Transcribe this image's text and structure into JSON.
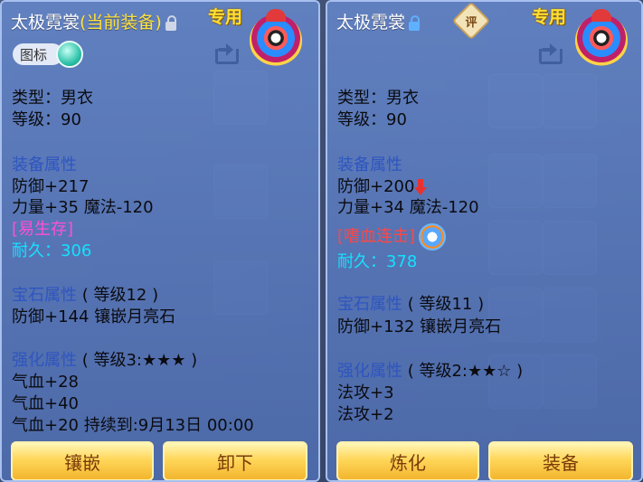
{
  "left": {
    "item_name": "太极霓裳",
    "equipped_tag": "(当前装备)",
    "exclusive": "专用",
    "icon_toggle_label": "图标",
    "type_line": "类型：男衣",
    "level_line": "等级：90",
    "equip_attr_title": "装备属性",
    "equip_attr_1": "防御+217",
    "equip_attr_2": "力量+35 魔法-120",
    "special_effect": "[易生存]",
    "durability": "耐久：306",
    "gem_title": "宝石属性",
    "gem_level": "( 等级12 )",
    "gem_attr": "防御+144 镶嵌月亮石",
    "enhance_title": "强化属性",
    "enhance_level": "( 等级3:★★★ )",
    "enhance_1": "气血+28",
    "enhance_2": "气血+40",
    "enhance_3": "气血+20   持续到:9月13日 00:00",
    "button_1": "镶嵌",
    "button_2": "卸下"
  },
  "right": {
    "item_name": "太极霓裳",
    "rating_badge": "评",
    "exclusive": "专用",
    "type_line": "类型：男衣",
    "level_line": "等级：90",
    "equip_attr_title": "装备属性",
    "equip_attr_1": "防御+200",
    "equip_attr_2": "力量+34 魔法-120",
    "special_effect": "[嗜血连击]",
    "durability": "耐久：378",
    "gem_title": "宝石属性",
    "gem_level": "( 等级11 )",
    "gem_attr": "防御+132 镶嵌月亮石",
    "enhance_title": "强化属性",
    "enhance_level": "( 等级2:★★☆ )",
    "enhance_1": "法攻+3",
    "enhance_2": "法攻+2",
    "button_1": "炼化",
    "button_2": "装备"
  },
  "colors": {
    "section_title": "#2e55c0",
    "durability": "#16e0ff",
    "special_left": "#ff4fd8",
    "special_right": "#ff4646",
    "equipped_tag": "#ffe23a",
    "exclusive": "#ffe033"
  },
  "icons": [
    "lock-open-icon",
    "lock-closed-icon",
    "share-icon",
    "emblem-icon",
    "down-arrow-icon",
    "skill-icon",
    "toggle-icon"
  ]
}
